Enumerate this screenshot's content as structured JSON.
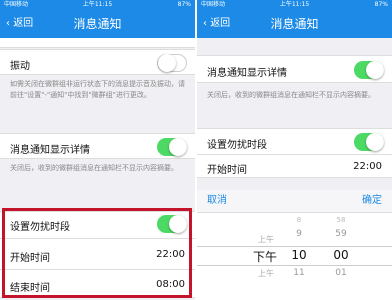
{
  "status": {
    "carrier": "中国移动",
    "time": "上午11:15",
    "battery": "87%"
  },
  "nav": {
    "back": "返回",
    "title": "消息通知"
  },
  "left": {
    "shake": "振动",
    "background_desc": "如需关闭在微群组非运行状态下的消息提示音及振动，请前往\"设置\"-\"通知\"中找到\"微群组\"进行更改。",
    "detail_label": "消息通知显示详情",
    "detail_desc": "关闭后，收到的微群组消息在通知栏不显示内容摘要。",
    "dnd_label": "设置勿扰时段",
    "start_label": "开始时间",
    "start_value": "22:00",
    "end_label": "结束时间",
    "end_value": "08:00"
  },
  "right": {
    "detail_label": "消息通知显示详情",
    "detail_desc": "关闭后，收到的微群组消息在通知栏不显示内容摘要。",
    "dnd_label": "设置勿扰时段",
    "start_label": "开始时间",
    "start_value": "22:00",
    "picker": {
      "cancel": "取消",
      "confirm": "确定",
      "ampm": [
        "上午",
        "下午",
        "上午"
      ],
      "hours": [
        "8",
        "9",
        "10",
        "11"
      ],
      "minutes": [
        "58",
        "59",
        "00",
        "01"
      ]
    }
  }
}
